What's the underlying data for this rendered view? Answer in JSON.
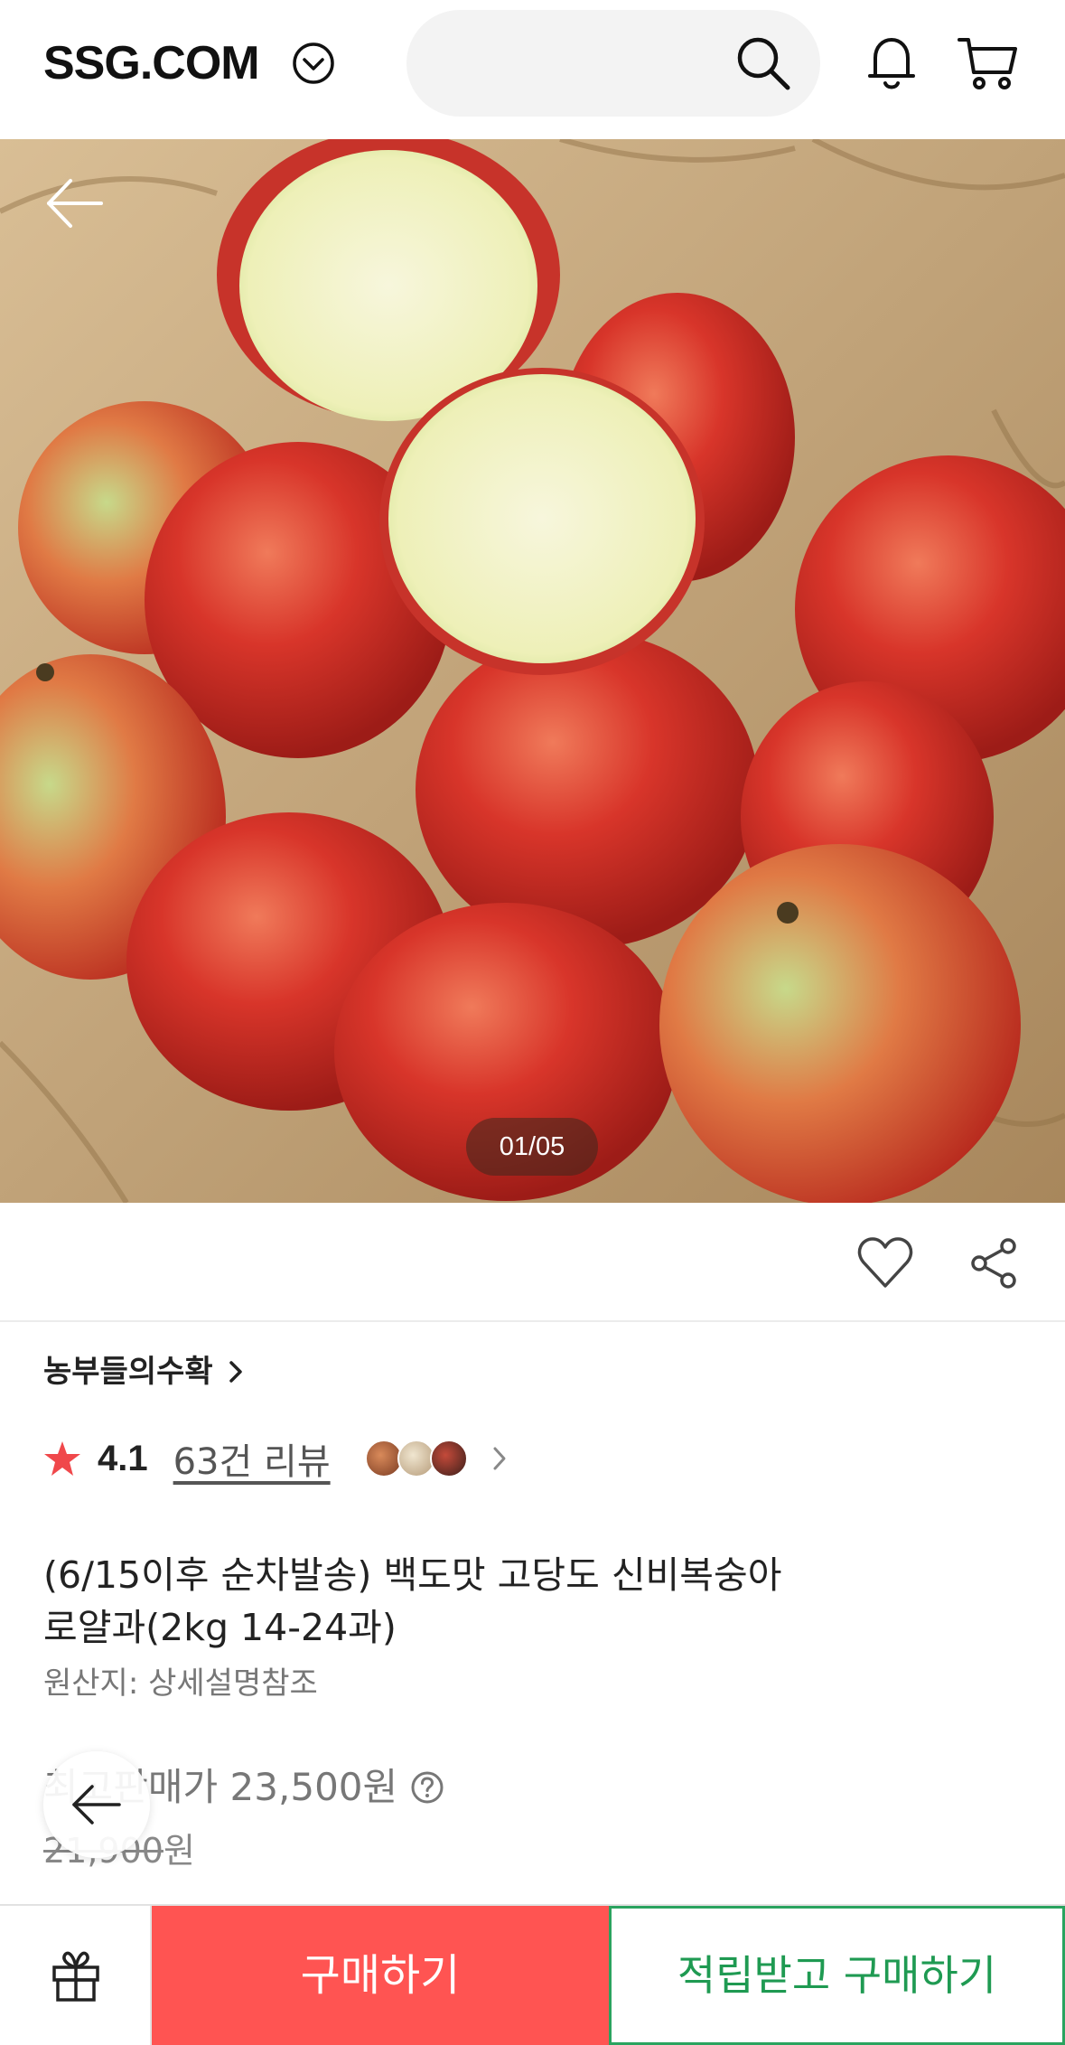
{
  "header": {
    "logo": "SSG.COM",
    "search_placeholder": ""
  },
  "gallery": {
    "counter": "01/05"
  },
  "seller": {
    "name": "농부들의수확"
  },
  "rating": {
    "score": "4.1",
    "review_link": "63건 리뷰"
  },
  "product": {
    "title_line1": "(6/15이후 순차발송) 백도맛 고당도 신비복숭아",
    "title_line2": "로얄과(2kg 14-24과)",
    "origin": "원산지: 상세설명참조"
  },
  "price": {
    "best_label": "최고판매가 23,500원",
    "original": "21,900",
    "original_unit": "원"
  },
  "bottom_bar": {
    "buy_label": "구매하기",
    "reward_buy_label": "적립받고 구매하기"
  },
  "colors": {
    "buy": "#ff5452",
    "reward": "#1f9a52",
    "star": "#f0484b"
  }
}
